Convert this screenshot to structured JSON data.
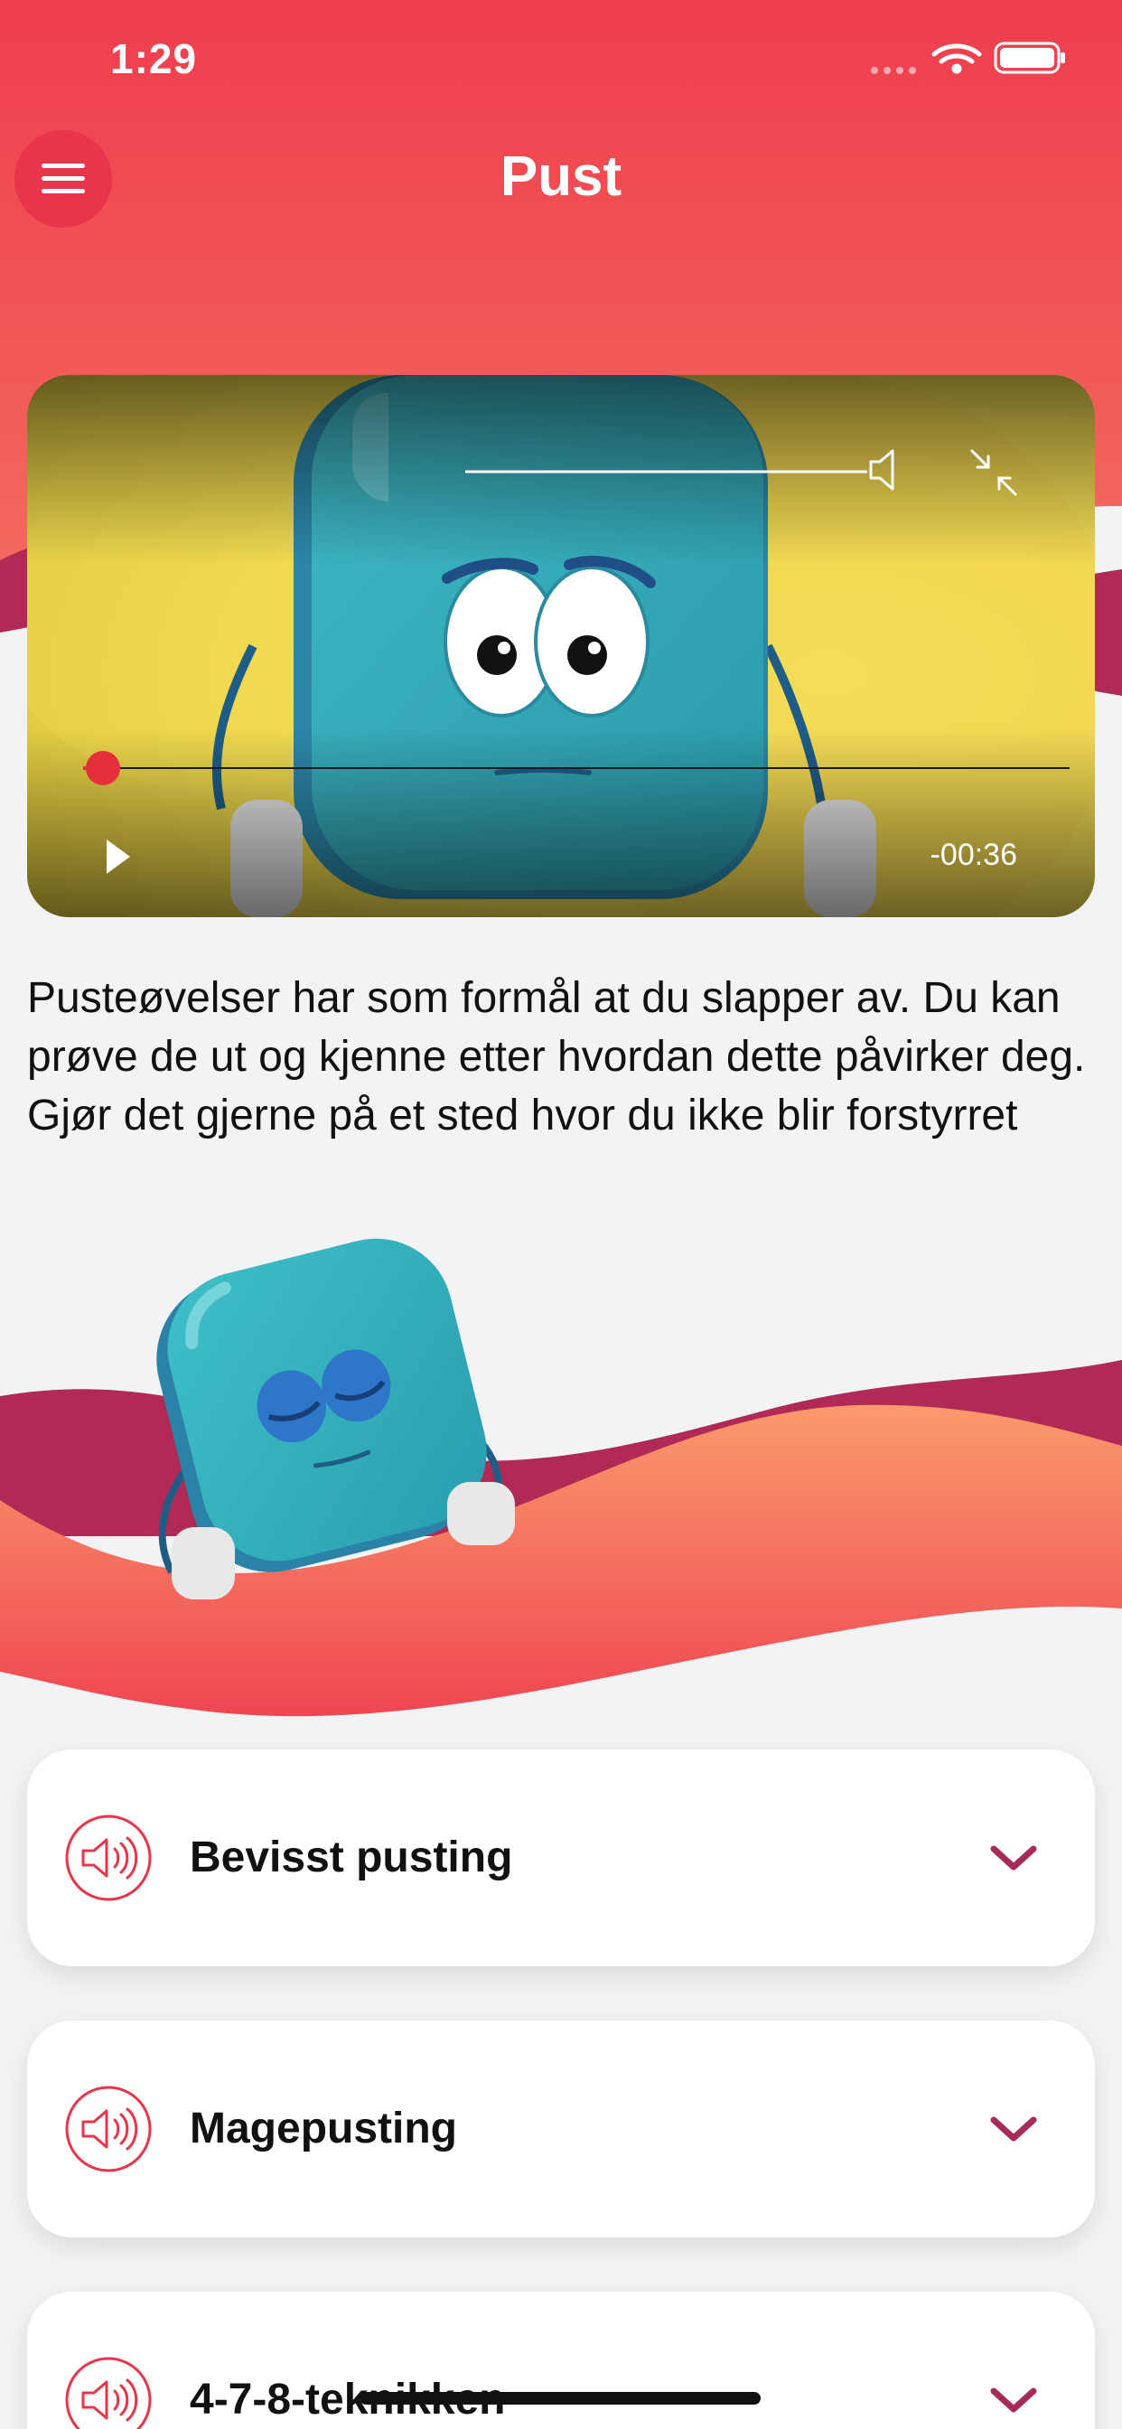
{
  "status_bar": {
    "time": "1:29"
  },
  "header": {
    "title": "Pust"
  },
  "video": {
    "remaining_time": "-00:36",
    "progress": 0.02
  },
  "intro": {
    "text": "Pusteøvelser har som formål at du slapper av. Du kan prøve de ut og kjenne etter hvordan dette påvirker deg. Gjør det gjerne på et sted hvor du ikke blir forstyrret"
  },
  "exercises": [
    {
      "label": "Bevisst pusting"
    },
    {
      "label": "Magepusting"
    },
    {
      "label": "4-7-8-teknikken"
    }
  ],
  "colors": {
    "header_red": "#ef4352",
    "accent_red": "#e8354a",
    "wave_orange": "#f7845a",
    "wave_magenta": "#b02a55",
    "chevron": "#a62a5a",
    "background": "#f2f3f5"
  },
  "icons": {
    "menu": "hamburger-menu-icon",
    "volume": "speaker-icon",
    "minimize": "exit-fullscreen-icon",
    "play": "play-icon",
    "audio": "audio-speaker-icon",
    "chevron": "chevron-down-icon"
  }
}
